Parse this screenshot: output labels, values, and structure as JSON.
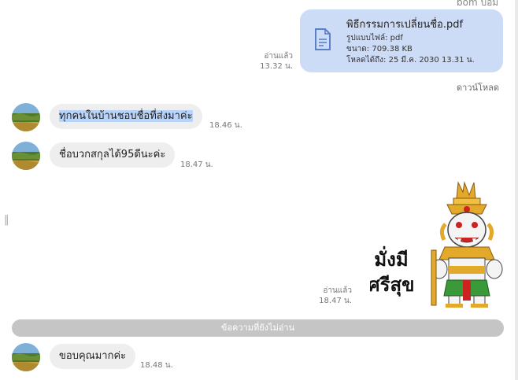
{
  "header": {
    "sender_name": "bom บ่อม"
  },
  "file_message": {
    "filename": "พิธีกรรมการเปลี่ยนชื่อ.pdf",
    "type_line": "รูปแบบไฟล์: pdf",
    "size_line": "ขนาด: 709.38 KB",
    "expiry_line": "โหลดได้ถึง: 25 มี.ค. 2030 13.31 น.",
    "read_label": "อ่านแล้ว",
    "time": "13.32 น.",
    "download_label": "ดาวน์โหลด"
  },
  "messages": [
    {
      "text": "ทุกคนในบ้านชอบชื่อที่ส่งมาค่ะ",
      "time": "18.46 น."
    },
    {
      "text": "ชื่อบวกสกุลได้95ดีนะค่ะ",
      "time": "18.47 น."
    }
  ],
  "sticker_message": {
    "line1": "มั่งมี",
    "line2": "ศรีสุข",
    "read_label": "อ่านแล้ว",
    "time": "18.47 น."
  },
  "unread_divider": "ข้อความที่ยังไม่อ่าน",
  "last_message": {
    "text": "ขอบคุณมากค่ะ",
    "time": "18.48 น."
  },
  "colors": {
    "own_bubble": "#cddcf6",
    "peer_bubble": "#eeeeee",
    "selection": "#b8d4fb",
    "divider": "#c5c5c5"
  }
}
